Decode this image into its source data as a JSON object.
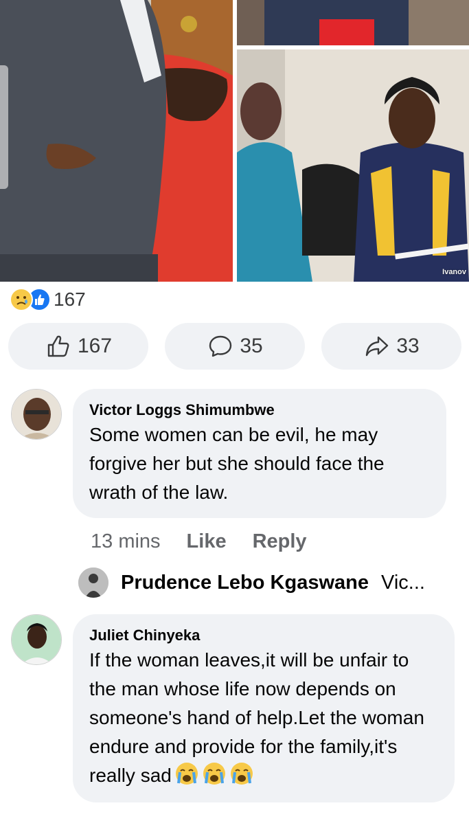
{
  "photos": {
    "watermark": "Ivanov"
  },
  "reactions": {
    "summary_count": "167",
    "summary_icons": [
      "sad-emoji",
      "like-icon"
    ],
    "like_count": "167",
    "comment_count": "35",
    "share_count": "33",
    "colors": {
      "like_blue": "#1877f2",
      "sad_yellow": "#f7c948",
      "button_bg": "#f0f2f5"
    }
  },
  "comments": [
    {
      "author": "Victor Loggs Shimumbwe",
      "text": "Some women can be evil, he may forgive her but she should face the wrath of the law.",
      "time": "13 mins",
      "like_label": "Like",
      "reply_label": "Reply",
      "reply_preview": {
        "author": "Prudence Lebo Kgaswane",
        "snippet": "Vic..."
      }
    },
    {
      "author": "Juliet Chinyeka",
      "text": "If the woman leaves,it will be unfair to the man whose life now depends on someone's hand of help.Let the woman endure and provide for the family,it's really sad",
      "emoji": [
        "loudly-crying-face",
        "loudly-crying-face",
        "loudly-crying-face"
      ]
    }
  ]
}
